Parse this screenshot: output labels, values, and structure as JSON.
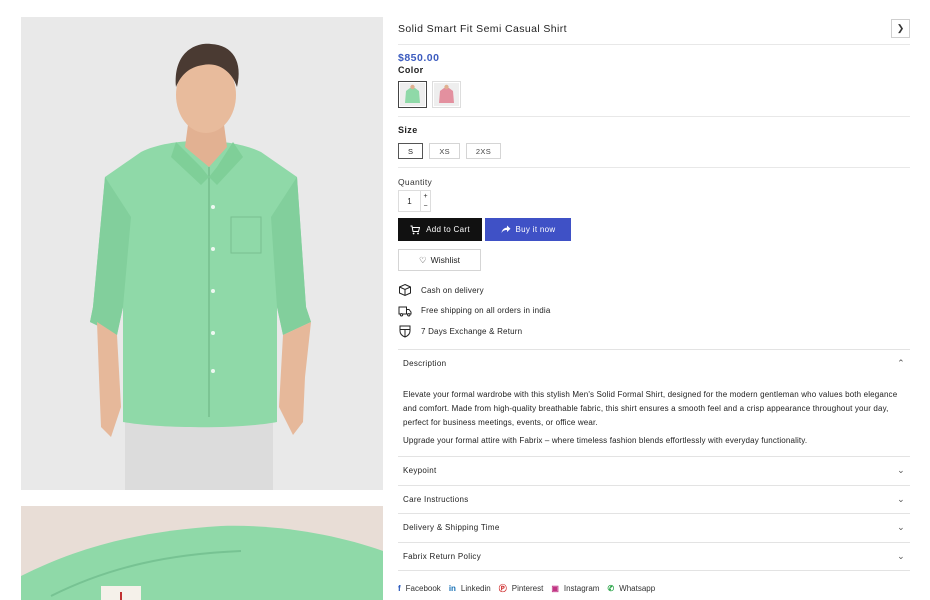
{
  "product": {
    "title": "Solid Smart Fit Semi Casual Shirt",
    "price": "$850.00",
    "color_label": "Color",
    "colors": [
      {
        "name": "green",
        "hex": "#8fd9a8",
        "selected": true
      },
      {
        "name": "pink",
        "hex": "#e3909f",
        "selected": false
      }
    ],
    "size_label": "Size",
    "sizes": [
      {
        "label": "S",
        "selected": true
      },
      {
        "label": "XS",
        "selected": false
      },
      {
        "label": "2XS",
        "selected": false
      }
    ],
    "quantity_label": "Quantity",
    "quantity": "1",
    "qty_plus": "+",
    "qty_minus": "−"
  },
  "actions": {
    "add_to_cart": "Add to Cart",
    "buy_now": "Buy it now",
    "wishlist": "Wishlist"
  },
  "features": [
    {
      "icon": "box-icon",
      "text": "Cash on delivery"
    },
    {
      "icon": "truck-icon",
      "text": "Free shipping on all orders in india"
    },
    {
      "icon": "shield-icon",
      "text": "7 Days Exchange & Return"
    }
  ],
  "accordion": {
    "description": {
      "title": "Description",
      "paragraph_1": "Elevate your formal wardrobe with this stylish Men's Solid Formal Shirt, designed for the modern gentleman who values both elegance and comfort. Made from high-quality breathable fabric, this shirt ensures a smooth feel and a crisp appearance throughout your day, perfect for business meetings, events, or office wear.",
      "paragraph_2": "Upgrade your formal attire with Fabrix – where timeless fashion blends effortlessly with everyday functionality."
    },
    "keypoint": "Keypoint",
    "care": "Care Instructions",
    "delivery": "Delivery & Shipping Time",
    "return_policy": "Fabrix Return Policy"
  },
  "share": {
    "facebook": "Facebook",
    "linkedin": "Linkedin",
    "pinterest": "Pinterest",
    "instagram": "Instagram",
    "whatsapp": "Whatsapp"
  },
  "colors": {
    "accent": "#3f51c6",
    "price": "#3b5bbf",
    "shirt": "#8fd9a8"
  }
}
